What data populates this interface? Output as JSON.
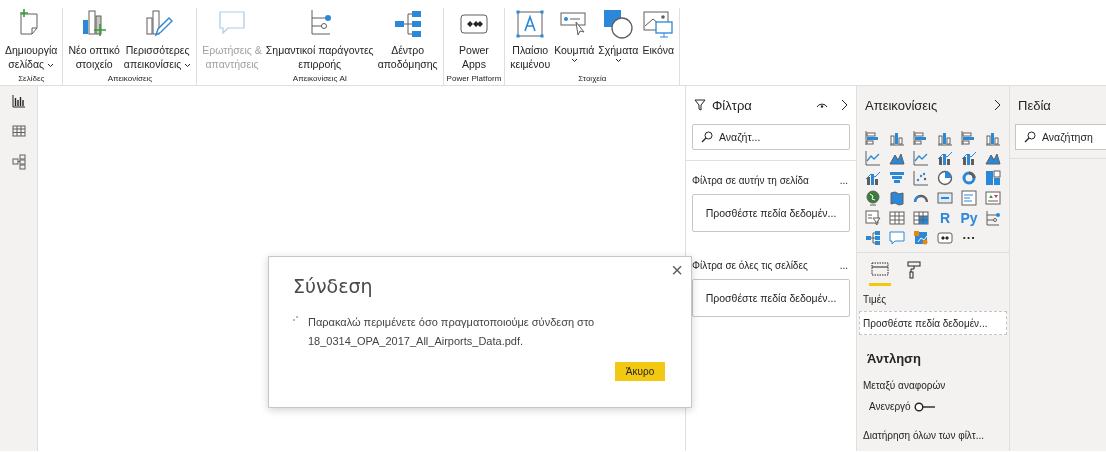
{
  "ribbon": {
    "groups": [
      {
        "label": "Σελίδες",
        "buttons": [
          {
            "lines": [
              "Δημιουργία",
              "σελίδας"
            ],
            "menu": true,
            "disabled": false
          }
        ]
      },
      {
        "label": "Απεικονίσεις",
        "buttons": [
          {
            "lines": [
              "Νέο οπτικό",
              "στοιχείο"
            ],
            "menu": false,
            "disabled": false
          },
          {
            "lines": [
              "Περισσότερες",
              "απεικονίσεις"
            ],
            "menu": true,
            "disabled": false
          }
        ]
      },
      {
        "label": "Απεικονίσεις AI",
        "buttons": [
          {
            "lines": [
              "Ερωτήσεις &",
              "απαντήσεις"
            ],
            "menu": false,
            "disabled": true
          },
          {
            "lines": [
              "Σημαντικοί παράγοντες",
              "επιρροής"
            ],
            "menu": false,
            "disabled": false
          },
          {
            "lines": [
              "Δέντρο",
              "αποδόμησης"
            ],
            "menu": false,
            "disabled": false
          }
        ]
      },
      {
        "label": "Power Platform",
        "buttons": [
          {
            "lines": [
              "Power",
              "Apps"
            ],
            "menu": false,
            "disabled": false
          }
        ]
      },
      {
        "label": "Στοιχεία",
        "buttons": [
          {
            "lines": [
              "Πλαίσιο",
              "κειμένου"
            ],
            "menu": false,
            "disabled": false
          },
          {
            "lines": [
              "Κουμπιά"
            ],
            "menu": true,
            "disabled": false
          },
          {
            "lines": [
              "Σχήματα"
            ],
            "menu": true,
            "disabled": false
          },
          {
            "lines": [
              "Εικόνα"
            ],
            "menu": false,
            "disabled": false
          }
        ]
      }
    ]
  },
  "dialog": {
    "title": "Σύνδεση",
    "close": "×",
    "message": "Παρακαλώ περιμένετε όσο πραγματοποιούμε σύνδεση στο 18_0314_OPA_2017_All_Airports_Data.pdf.",
    "cancel": "Άκυρο"
  },
  "filters": {
    "title": "Φίλτρα",
    "search": {
      "placeholder": "Αναζήτ..."
    },
    "sections": [
      {
        "title": "Φίλτρα σε αυτήν τη σελίδα",
        "menu": "...",
        "well": "Προσθέστε πεδία δεδομέν..."
      },
      {
        "title": "Φίλτρα σε όλες τις σελίδες",
        "menu": "...",
        "well": "Προσθέστε πεδία δεδομέν..."
      }
    ]
  },
  "visualizations": {
    "title": "Απεικονίσεις",
    "script_visuals": [
      "R",
      "Py"
    ],
    "more": "···",
    "tabs": [
      {
        "selected": true
      },
      {
        "selected": false
      }
    ],
    "well_label": "Τιμές",
    "well": "Προσθέστε πεδία δεδομέν...",
    "drillthrough": {
      "title": "Άντληση",
      "cross_report": "Μεταξύ αναφορών",
      "toggle": {
        "label": "Ανενεργό",
        "on": false
      },
      "keep_filters": "Διατήρηση όλων των φίλτ..."
    }
  },
  "fields": {
    "title": "Πεδία",
    "search": {
      "placeholder": "Αναζήτηση"
    }
  }
}
